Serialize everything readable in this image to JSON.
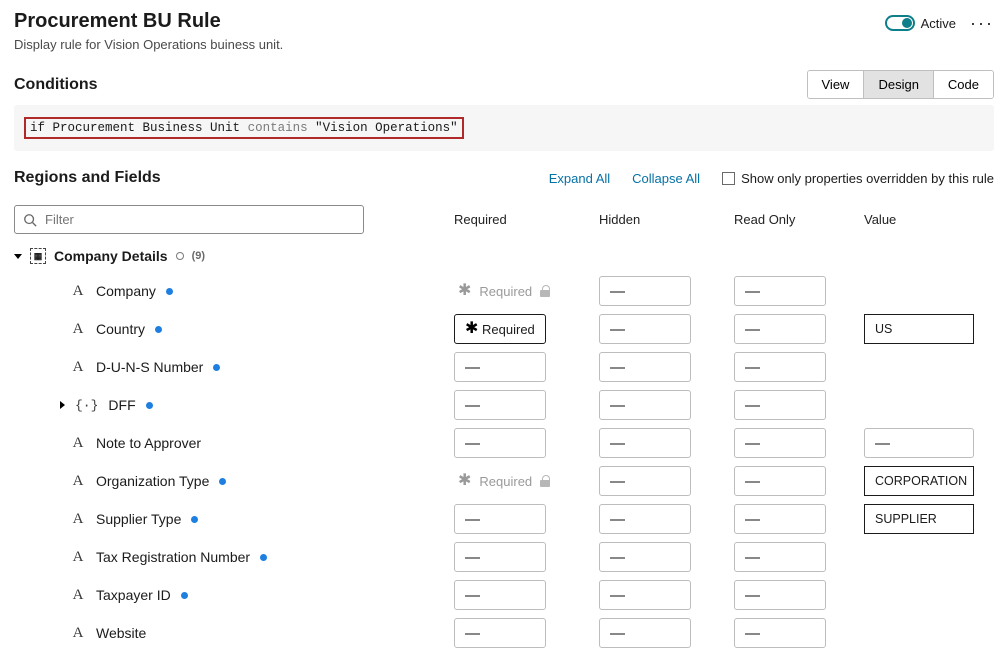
{
  "header": {
    "title": "Procurement BU Rule",
    "subtitle": "Display rule for Vision Operations buiness unit.",
    "active_label": "Active"
  },
  "conditions": {
    "section_title": "Conditions",
    "tabs": {
      "view": "View",
      "design": "Design",
      "code": "Code"
    },
    "expr_if": "if",
    "expr_field": "Procurement Business Unit",
    "expr_op": "contains",
    "expr_value": "\"Vision Operations\""
  },
  "regions": {
    "section_title": "Regions and Fields",
    "expand": "Expand All",
    "collapse": "Collapse All",
    "show_overridden": "Show only properties overridden by this rule",
    "filter_placeholder": "Filter",
    "columns": {
      "required": "Required",
      "hidden": "Hidden",
      "readonly": "Read Only",
      "value": "Value"
    },
    "group": {
      "name": "Company Details",
      "count": "(9)"
    },
    "fields": {
      "company": {
        "label": "Company",
        "required_locked": "Required"
      },
      "country": {
        "label": "Country",
        "required_text": "Required",
        "value": "US"
      },
      "duns": {
        "label": "D-U-N-S Number"
      },
      "dff": {
        "label": "DFF"
      },
      "note": {
        "label": "Note to Approver"
      },
      "orgtype": {
        "label": "Organization Type",
        "required_locked": "Required",
        "value": "CORPORATION"
      },
      "suptype": {
        "label": "Supplier Type",
        "value": "SUPPLIER"
      },
      "taxreg": {
        "label": "Tax Registration Number"
      },
      "taxpayer": {
        "label": "Taxpayer ID"
      },
      "website": {
        "label": "Website"
      }
    }
  }
}
